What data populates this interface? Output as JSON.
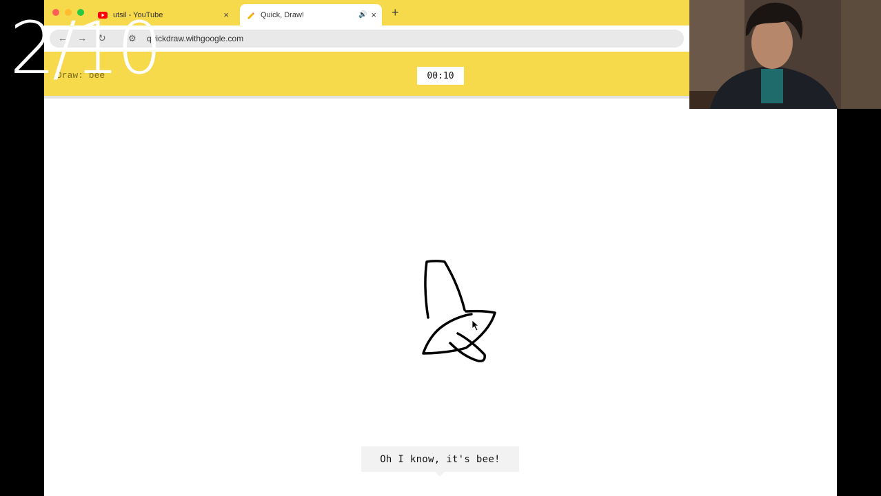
{
  "browser": {
    "tabs": [
      {
        "label": "utsil - YouTube",
        "favicon": "youtube-icon"
      },
      {
        "label": "Quick, Draw!",
        "favicon": "quickdraw-pencil-icon",
        "audio": true
      }
    ],
    "close_glyph": "×",
    "audio_glyph": "🔊",
    "new_tab_glyph": "+",
    "url": "quickdraw.withgoogle.com"
  },
  "game": {
    "prompt": "Draw: bee",
    "timer": "00:10",
    "guess": "Oh I know, it's bee!"
  },
  "overlay": {
    "counter": "2/10"
  },
  "colors": {
    "accent": "#f7d94c",
    "traffic_close": "#ff5f57",
    "traffic_min": "#febc2e",
    "traffic_max": "#28c840",
    "youtube": "#ff0000"
  }
}
